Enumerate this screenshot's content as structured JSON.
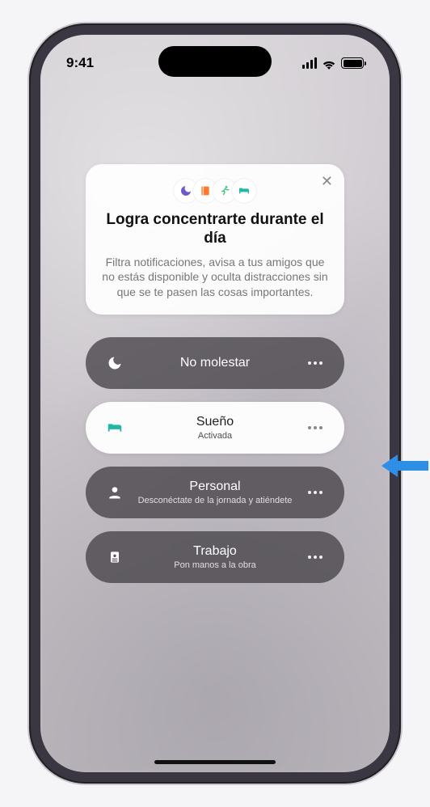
{
  "status": {
    "time": "9:41"
  },
  "card": {
    "title": "Logra concentrarte durante el día",
    "description": "Filtra notificaciones, avisa a tus amigos que no estás disponible y oculta distracciones sin que se te pasen las cosas importantes.",
    "icons": [
      "moon-icon",
      "book-icon",
      "running-icon",
      "bed-icon"
    ],
    "icon_colors": [
      "#6a5acd",
      "#ff7a2f",
      "#2ecc71",
      "#1fb8a6"
    ]
  },
  "modes": [
    {
      "icon": "moon-icon",
      "label": "No molestar",
      "sub": "",
      "style": "dark"
    },
    {
      "icon": "bed-icon",
      "label": "Sueño",
      "sub": "Activada",
      "style": "light",
      "icon_color": "#1fb8a6",
      "highlighted": true
    },
    {
      "icon": "person-icon",
      "label": "Personal",
      "sub": "Desconéctate de la jornada y atiéndete",
      "style": "dark"
    },
    {
      "icon": "badge-icon",
      "label": "Trabajo",
      "sub": "Pon manos a la obra",
      "style": "dark"
    }
  ],
  "colors": {
    "callout_arrow": "#2f8fe6"
  }
}
